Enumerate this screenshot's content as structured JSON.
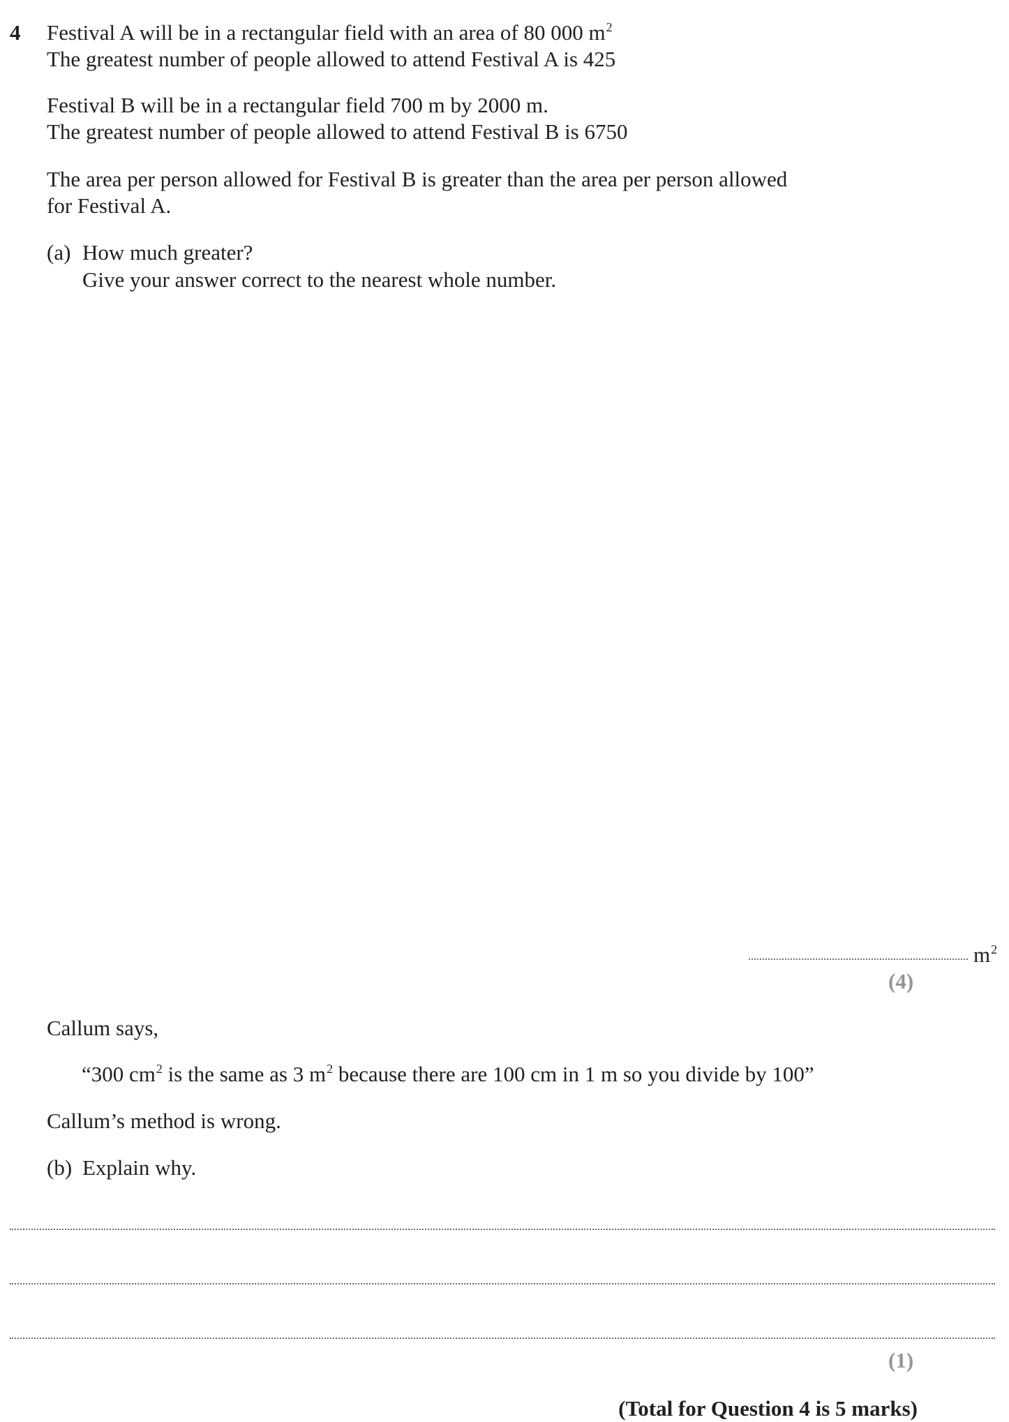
{
  "question": {
    "number": "4",
    "intro": {
      "a1": "Festival A will be in a rectangular field with an area of 80 000 m",
      "a1_sup": "2",
      "a2": "The greatest number of people allowed to attend Festival A is 425",
      "b1": "Festival B will be in a rectangular field 700 m by 2000 m.",
      "b2": "The greatest number of people allowed to attend Festival B is 6750",
      "c1": "The area per person allowed for Festival B is greater than the area per person allowed",
      "c2": "for Festival A."
    },
    "part_a": {
      "label": "(a)",
      "line1": "How much greater?",
      "line2": "Give your answer correct to the nearest whole number.",
      "answer_unit": "m",
      "answer_unit_sup": "2",
      "marks": "(4)"
    },
    "statement": {
      "intro": "Callum says,",
      "quote_open": "“300 cm",
      "sup1": "2",
      "quote_mid": " is the same as 3 m",
      "sup2": "2",
      "quote_end": " because there are 100 cm in 1 m so you divide by 100”",
      "verdict": "Callum’s method is wrong."
    },
    "part_b": {
      "label": "(b)",
      "prompt": "Explain why.",
      "marks": "(1)"
    },
    "total": "(Total for Question 4 is 5 marks)"
  }
}
